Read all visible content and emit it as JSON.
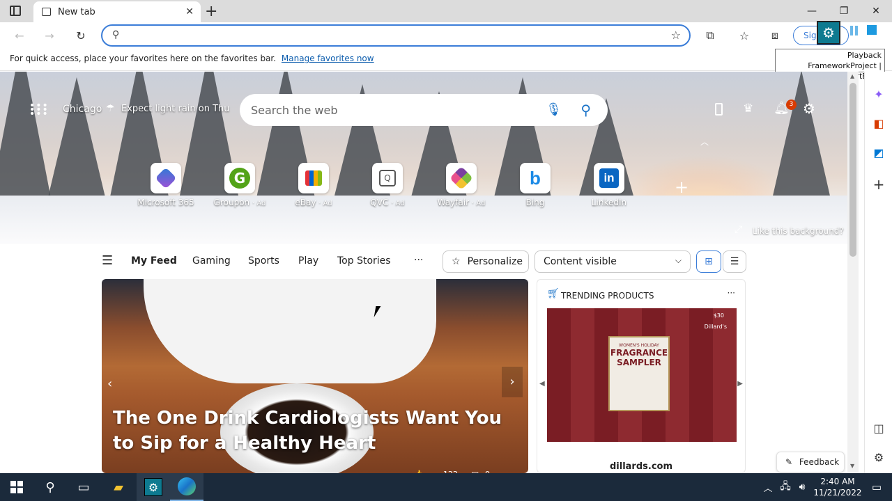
{
  "browser": {
    "tab_title": "New tab",
    "address_value": "",
    "sign_in_label": "Sig",
    "favorites_bar_text": "For quick access, place your favorites here on the favorites bar.",
    "favorites_bar_link": "Manage favorites now"
  },
  "tooltip": {
    "line1": "Playback",
    "line2": "FrameworkProject | StartEdge"
  },
  "newtab": {
    "location": "Chicago",
    "weather": "Expect light rain on Thu",
    "search_placeholder": "Search the web",
    "notification_count": "3",
    "background_prompt": "Like this background?",
    "quick_links": [
      {
        "name": "Microsoft 365",
        "ad": ""
      },
      {
        "name": "Groupon",
        "ad": "· Ad"
      },
      {
        "name": "eBay",
        "ad": "· Ad"
      },
      {
        "name": "QVC",
        "ad": "· Ad"
      },
      {
        "name": "Wayfair",
        "ad": "· Ad"
      },
      {
        "name": "Bing",
        "ad": ""
      },
      {
        "name": "LinkedIn",
        "ad": ""
      }
    ]
  },
  "feed_nav": {
    "items": [
      "My Feed",
      "Gaming",
      "Sports",
      "Play",
      "Top Stories"
    ],
    "more": "···",
    "personalize": "Personalize",
    "content_select": "Content visible"
  },
  "main_card": {
    "headline": "The One Drink Cardiologists Want You to Sip for a Healthy Heart",
    "reactions": "122",
    "comments": "0"
  },
  "trending": {
    "title": "TRENDING PRODUCTS",
    "source": "dillards.com",
    "product_line1": "WOMEN'S HOLIDAY",
    "product_line2": "FRAGRANCE",
    "product_line3": "SAMPLER",
    "price": "$30",
    "brand": "Dillard's"
  },
  "feedback_label": "Feedback",
  "taskbar": {
    "time": "2:40 AM",
    "date": "11/21/2022"
  },
  "colors": {
    "accent": "#3b7dd8",
    "link": "#0b5cad",
    "taskbar": "#1b2a3b"
  }
}
